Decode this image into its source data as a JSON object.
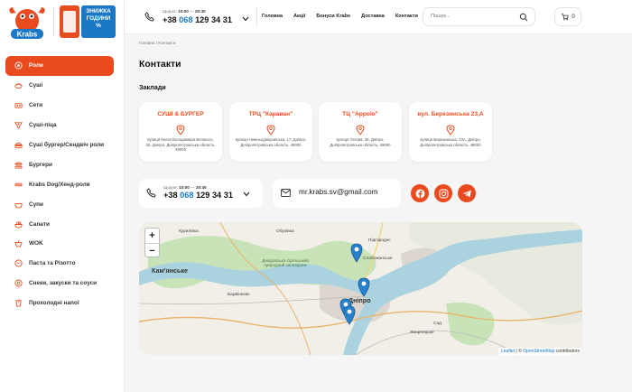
{
  "brand": {
    "logo_text": "mr Krabs",
    "promo_line1": "ЗНИЖКА",
    "promo_line2": "ГОДИНИ",
    "promo_line3": "%"
  },
  "sidebar": {
    "items": [
      {
        "label": "Роли",
        "icon": "roll-icon",
        "active": true
      },
      {
        "label": "Суші",
        "icon": "sushi-icon"
      },
      {
        "label": "Сети",
        "icon": "set-icon"
      },
      {
        "label": "Суші-піца",
        "icon": "pizza-icon"
      },
      {
        "label": "Суші бургер/Сендвіч роли",
        "icon": "burger-roll-icon"
      },
      {
        "label": "Бургери",
        "icon": "burger-icon"
      },
      {
        "label": "Krabs Dog/Хенд-роли",
        "icon": "hotdog-icon"
      },
      {
        "label": "Супи",
        "icon": "soup-icon"
      },
      {
        "label": "Салати",
        "icon": "salad-icon"
      },
      {
        "label": "WOK",
        "icon": "wok-icon"
      },
      {
        "label": "Паста та Різотто",
        "icon": "pasta-icon"
      },
      {
        "label": "Снеки, закуски та соуси",
        "icon": "snack-icon"
      },
      {
        "label": "Прохолодні напої",
        "icon": "drink-icon"
      }
    ]
  },
  "header": {
    "hours_prefix": "Щодня:",
    "hours_from": "10:00",
    "hours_sep": "—",
    "hours_to": "20:40",
    "phone_prefix": "+38",
    "phone_code": "068",
    "phone_number": "129 34 31",
    "nav": [
      "Головна",
      "Акції",
      "Бонуси Krabs",
      "Доставка",
      "Контакти"
    ],
    "search_placeholder": "Пошук...",
    "cart_count": "0"
  },
  "breadcrumb": {
    "home": "Головна",
    "sep": " / ",
    "current": "Контакти"
  },
  "page_title": "Контакти",
  "section_title": "Заклади",
  "locations": [
    {
      "name": "СУШІ & БУРГЕР",
      "address": "вулиця Князя Володимира Великого, 26, Дніпро, Дніпропетровська область, 49000"
    },
    {
      "name": "ТРЦ \"Караван\"",
      "address": "вулиця Нижньодніпровська, 17, Дніпро, Дніпропетровська область, 49000"
    },
    {
      "name": "ТЦ \"Appolo\"",
      "address": "вулиця Титова, 36, Дніпро, Дніпропетровська область, 49000"
    },
    {
      "name": "вул. Березинська 23,А",
      "address": "вулиця Березинська, 23А, Дніпро, Дніпропетровська область, 49000"
    }
  ],
  "contacts": {
    "hours_prefix": "Щодня:",
    "hours_from": "10:00",
    "hours_sep": "—",
    "hours_to": "20:40",
    "phone_prefix": "+38",
    "phone_code": "068",
    "phone_number": "129 34 31",
    "email": "mr.krabs.sv@gmail.com",
    "socials": [
      "facebook-icon",
      "instagram-icon",
      "telegram-icon"
    ]
  },
  "map": {
    "zoom_in": "+",
    "zoom_out": "−",
    "labels": {
      "kamianske": "Кам'янське",
      "dnipro": "Дніпро",
      "kurylivka": "Курилівка",
      "obukhivka": "Обухівка",
      "pidhorodne": "Підгороднє",
      "sloboda": "Слобожанське",
      "barvinkove": "Барвінкове",
      "nature_reserve": "Дніпровсько-Орільський природний заповідник",
      "yavornytske": "Яворницьке",
      "sad": "Сад"
    },
    "attribution_leaflet": "Leaflet",
    "attribution_sep": " | © ",
    "attribution_osm": "OpenStreetMap",
    "attribution_suffix": " contributors",
    "colors": {
      "water": "#aad3df",
      "land": "#f2efe9",
      "green": "#c8e3b8",
      "urban": "#dcd6cf",
      "marker": "#2a81cb"
    }
  },
  "colors": {
    "accent": "#ea4b1e",
    "phone_blue": "#1b78c6"
  }
}
